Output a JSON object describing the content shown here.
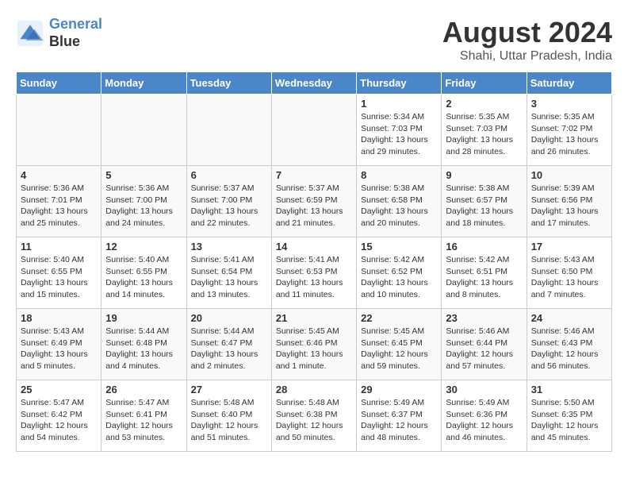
{
  "header": {
    "logo_line1": "General",
    "logo_line2": "Blue",
    "month_year": "August 2024",
    "location": "Shahi, Uttar Pradesh, India"
  },
  "weekdays": [
    "Sunday",
    "Monday",
    "Tuesday",
    "Wednesday",
    "Thursday",
    "Friday",
    "Saturday"
  ],
  "weeks": [
    [
      {
        "day": "",
        "empty": true
      },
      {
        "day": "",
        "empty": true
      },
      {
        "day": "",
        "empty": true
      },
      {
        "day": "",
        "empty": true
      },
      {
        "day": "1",
        "sunrise": "5:34 AM",
        "sunset": "7:03 PM",
        "daylight": "13 hours and 29 minutes."
      },
      {
        "day": "2",
        "sunrise": "5:35 AM",
        "sunset": "7:03 PM",
        "daylight": "13 hours and 28 minutes."
      },
      {
        "day": "3",
        "sunrise": "5:35 AM",
        "sunset": "7:02 PM",
        "daylight": "13 hours and 26 minutes."
      }
    ],
    [
      {
        "day": "4",
        "sunrise": "5:36 AM",
        "sunset": "7:01 PM",
        "daylight": "13 hours and 25 minutes."
      },
      {
        "day": "5",
        "sunrise": "5:36 AM",
        "sunset": "7:00 PM",
        "daylight": "13 hours and 24 minutes."
      },
      {
        "day": "6",
        "sunrise": "5:37 AM",
        "sunset": "7:00 PM",
        "daylight": "13 hours and 22 minutes."
      },
      {
        "day": "7",
        "sunrise": "5:37 AM",
        "sunset": "6:59 PM",
        "daylight": "13 hours and 21 minutes."
      },
      {
        "day": "8",
        "sunrise": "5:38 AM",
        "sunset": "6:58 PM",
        "daylight": "13 hours and 20 minutes."
      },
      {
        "day": "9",
        "sunrise": "5:38 AM",
        "sunset": "6:57 PM",
        "daylight": "13 hours and 18 minutes."
      },
      {
        "day": "10",
        "sunrise": "5:39 AM",
        "sunset": "6:56 PM",
        "daylight": "13 hours and 17 minutes."
      }
    ],
    [
      {
        "day": "11",
        "sunrise": "5:40 AM",
        "sunset": "6:55 PM",
        "daylight": "13 hours and 15 minutes."
      },
      {
        "day": "12",
        "sunrise": "5:40 AM",
        "sunset": "6:55 PM",
        "daylight": "13 hours and 14 minutes."
      },
      {
        "day": "13",
        "sunrise": "5:41 AM",
        "sunset": "6:54 PM",
        "daylight": "13 hours and 13 minutes."
      },
      {
        "day": "14",
        "sunrise": "5:41 AM",
        "sunset": "6:53 PM",
        "daylight": "13 hours and 11 minutes."
      },
      {
        "day": "15",
        "sunrise": "5:42 AM",
        "sunset": "6:52 PM",
        "daylight": "13 hours and 10 minutes."
      },
      {
        "day": "16",
        "sunrise": "5:42 AM",
        "sunset": "6:51 PM",
        "daylight": "13 hours and 8 minutes."
      },
      {
        "day": "17",
        "sunrise": "5:43 AM",
        "sunset": "6:50 PM",
        "daylight": "13 hours and 7 minutes."
      }
    ],
    [
      {
        "day": "18",
        "sunrise": "5:43 AM",
        "sunset": "6:49 PM",
        "daylight": "13 hours and 5 minutes."
      },
      {
        "day": "19",
        "sunrise": "5:44 AM",
        "sunset": "6:48 PM",
        "daylight": "13 hours and 4 minutes."
      },
      {
        "day": "20",
        "sunrise": "5:44 AM",
        "sunset": "6:47 PM",
        "daylight": "13 hours and 2 minutes."
      },
      {
        "day": "21",
        "sunrise": "5:45 AM",
        "sunset": "6:46 PM",
        "daylight": "13 hours and 1 minute."
      },
      {
        "day": "22",
        "sunrise": "5:45 AM",
        "sunset": "6:45 PM",
        "daylight": "12 hours and 59 minutes."
      },
      {
        "day": "23",
        "sunrise": "5:46 AM",
        "sunset": "6:44 PM",
        "daylight": "12 hours and 57 minutes."
      },
      {
        "day": "24",
        "sunrise": "5:46 AM",
        "sunset": "6:43 PM",
        "daylight": "12 hours and 56 minutes."
      }
    ],
    [
      {
        "day": "25",
        "sunrise": "5:47 AM",
        "sunset": "6:42 PM",
        "daylight": "12 hours and 54 minutes."
      },
      {
        "day": "26",
        "sunrise": "5:47 AM",
        "sunset": "6:41 PM",
        "daylight": "12 hours and 53 minutes."
      },
      {
        "day": "27",
        "sunrise": "5:48 AM",
        "sunset": "6:40 PM",
        "daylight": "12 hours and 51 minutes."
      },
      {
        "day": "28",
        "sunrise": "5:48 AM",
        "sunset": "6:38 PM",
        "daylight": "12 hours and 50 minutes."
      },
      {
        "day": "29",
        "sunrise": "5:49 AM",
        "sunset": "6:37 PM",
        "daylight": "12 hours and 48 minutes."
      },
      {
        "day": "30",
        "sunrise": "5:49 AM",
        "sunset": "6:36 PM",
        "daylight": "12 hours and 46 minutes."
      },
      {
        "day": "31",
        "sunrise": "5:50 AM",
        "sunset": "6:35 PM",
        "daylight": "12 hours and 45 minutes."
      }
    ]
  ]
}
